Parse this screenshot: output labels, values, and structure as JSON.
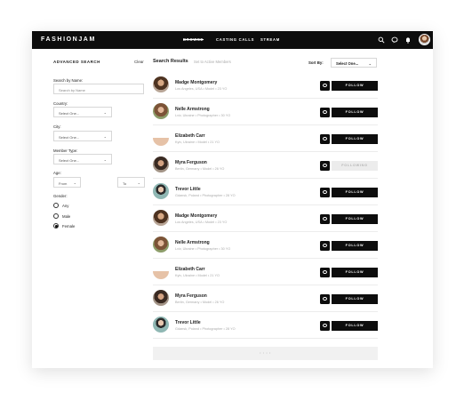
{
  "app": {
    "logo": "FASHIONJAM",
    "nav": [
      {
        "label": "BROWSE"
      },
      {
        "label": "CASTING CALLS"
      },
      {
        "label": "STREAM"
      }
    ],
    "icons": [
      "search-icon",
      "chat-icon",
      "bell-icon",
      "avatar"
    ]
  },
  "sidebar": {
    "title": "ADVANCED SEARCH",
    "clear": "Clear",
    "search_by_name_label": "Search by Name:",
    "search_by_name_placeholder": "Search by Name",
    "country_label": "Country:",
    "country_value": "Select One...",
    "city_label": "City:",
    "city_value": "Select One...",
    "member_type_label": "Member Type:",
    "member_type_value": "Select One...",
    "age_label": "Age:",
    "age_from": "From",
    "age_to": "To",
    "gender_label": "Gender:",
    "gender_options": [
      {
        "label": "Any",
        "checked": false
      },
      {
        "label": "Male",
        "checked": false
      },
      {
        "label": "Female",
        "checked": true
      }
    ]
  },
  "results": {
    "title": "Search Results",
    "active_link": "Set to Active Members",
    "sort_label": "Sort By:",
    "sort_value": "Select One...",
    "load_more": "• • • •",
    "rows": [
      {
        "name": "Madge Montgomery",
        "meta": "Los Angeles, USA  •  Model  •  23 YO",
        "button": "FOLLOW",
        "state": "follow",
        "avatar": "a1"
      },
      {
        "name": "Nelle Armstrong",
        "meta": "Lviv, Ukraine  •  Photographer  •  30 YO",
        "button": "FOLLOW",
        "state": "follow",
        "avatar": "a2"
      },
      {
        "name": "Elizabeth Carr",
        "meta": "Kyiv, Ukraine  •  Model  •  21 YO",
        "button": "FOLLOW",
        "state": "follow",
        "avatar": "a3"
      },
      {
        "name": "Myra Ferguson",
        "meta": "Berlin, Germany  •  Model  •  26 YO",
        "button": "FOLLOWING",
        "state": "following",
        "avatar": "a4"
      },
      {
        "name": "Trevor Little",
        "meta": "Gdansk, Poland  •  Photographer  •  28 YO",
        "button": "FOLLOW",
        "state": "follow",
        "avatar": "a5"
      },
      {
        "name": "Madge Montgomery",
        "meta": "Los Angeles, USA  •  Model  •  23 YO",
        "button": "FOLLOW",
        "state": "follow",
        "avatar": "a1"
      },
      {
        "name": "Nelle Armstrong",
        "meta": "Lviv, Ukraine  •  Photographer  •  30 YO",
        "button": "FOLLOW",
        "state": "follow",
        "avatar": "a2"
      },
      {
        "name": "Elizabeth Carr",
        "meta": "Kyiv, Ukraine  •  Model  •  21 YO",
        "button": "FOLLOW",
        "state": "follow",
        "avatar": "a3"
      },
      {
        "name": "Myra Ferguson",
        "meta": "Berlin, Germany  •  Model  •  26 YO",
        "button": "FOLLOW",
        "state": "follow",
        "avatar": "a4"
      },
      {
        "name": "Trevor Little",
        "meta": "Gdansk, Poland  •  Photographer  •  28 YO",
        "button": "FOLLOW",
        "state": "follow",
        "avatar": "a5"
      }
    ]
  }
}
